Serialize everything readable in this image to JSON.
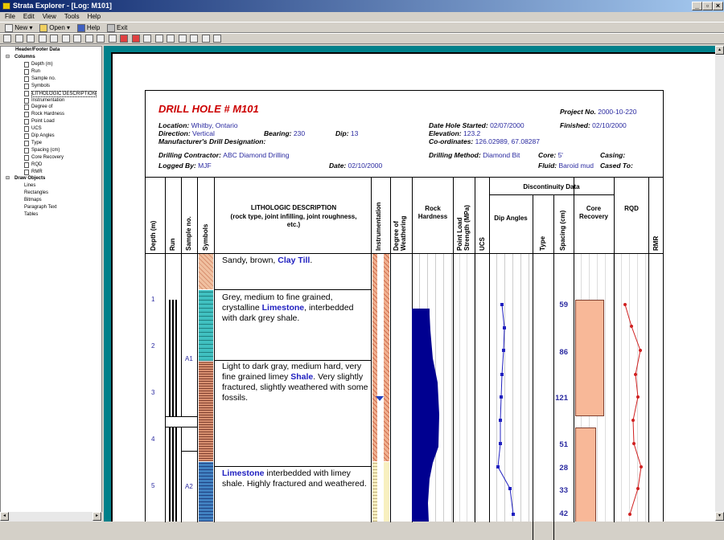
{
  "window": {
    "title": "Strata Explorer - [Log: M101]"
  },
  "menu": [
    "File",
    "Edit",
    "View",
    "Tools",
    "Help"
  ],
  "toolbar1": {
    "new": "New",
    "open": "Open",
    "help": "Help",
    "exit": "Exit"
  },
  "tree": {
    "root": "Header/Footer Data",
    "columns_label": "Columns",
    "columns": [
      "Depth (m)",
      "Run",
      "Sample no.",
      "Symbols",
      "LITHOLOGIC DESCRIPTION",
      "Instrumentation",
      "Degree of",
      "Rock Hardness",
      "Point Load",
      "UCS",
      "Dip Angles",
      "Type",
      "Spacing (cm)",
      "Core Recovery",
      "RQD",
      "RMR"
    ],
    "draw_label": "Draw Objects",
    "draw": [
      "Lines",
      "Rectangles",
      "Bitmaps",
      "Paragraph Text",
      "Tables"
    ]
  },
  "header": {
    "title": "DRILL HOLE # M101",
    "project_label": "Project No.",
    "project": "2000-10-220",
    "location_label": "Location:",
    "location": "Whitby, Ontario",
    "direction_label": "Direction:",
    "direction": "Vertical",
    "bearing_label": "Bearing:",
    "bearing": "230",
    "dip_label": "Dip:",
    "dip": "13",
    "started_label": "Date Hole Started:",
    "started": "02/07/2000",
    "finished_label": "Finished:",
    "finished": "02/10/2000",
    "elevation_label": "Elevation:",
    "elevation": "123.2",
    "designation_label": "Manufacturer's Drill Designation:",
    "coords_label": "Co-ordinates:",
    "coords": "126.02989, 67.08287",
    "contractor_label": "Drilling Contractor:",
    "contractor": "ABC Diamond Drilling",
    "method_label": "Drilling Method:",
    "method": "Diamond Bit",
    "core_label": "Core:",
    "core": "5'",
    "casing_label": "Casing:",
    "logged_label": "Logged By:",
    "logged": "MJF",
    "date_label": "Date:",
    "date": "02/10/2000",
    "fluid_label": "Fluid:",
    "fluid": "Baroid mud",
    "cased_label": "Cased To:"
  },
  "columns": {
    "depth": "Depth (m)",
    "run": "Run",
    "sample": "Sample no.",
    "symbols": "Symbols",
    "litho_title": "LITHOLOGIC DESCRIPTION",
    "litho_sub": "(rock type, joint infilling, joint roughness, etc.)",
    "instr": "Instrumentation",
    "weather": "Degree of Weathering",
    "hardness": "Rock Hardness",
    "pointload": "Point Load Strength (MPa)",
    "ucs": "UCS",
    "disc": "Discontinuity Data",
    "dip": "Dip Angles",
    "type": "Type",
    "spacing": "Spacing (cm)",
    "recovery": "Core Recovery",
    "rqd": "RQD",
    "rmr": "RMR"
  },
  "descriptions": [
    {
      "pre": "Sandy, brown, ",
      "rock": "Clay Till",
      "post": "."
    },
    {
      "pre": "Grey, medium to fine grained, crystalline ",
      "rock": "Limestone",
      "post": ", interbedded with dark grey shale."
    },
    {
      "pre": "Light to dark gray, medium hard, very fine grained limey ",
      "rock": "Shale",
      "post": ". Very slightly fractured, slightly weathered with some fossils."
    },
    {
      "pre": "",
      "rock": "Limestone",
      "post": " interbedded with limey shale. Highly fractured and weathered."
    }
  ],
  "depths": [
    "1",
    "2",
    "3",
    "4",
    "5"
  ],
  "samples": [
    "A1",
    "A2"
  ],
  "spacing": [
    "59",
    "86",
    "121",
    "51",
    "28",
    "33",
    "42"
  ],
  "colors": {
    "accent": "#cc0000",
    "value": "#2a2aa0",
    "teal": "#00808a",
    "shale": "#d89070",
    "limestone": "#40c0c0",
    "recovery": "#f8b898",
    "hardness": "#000090"
  }
}
